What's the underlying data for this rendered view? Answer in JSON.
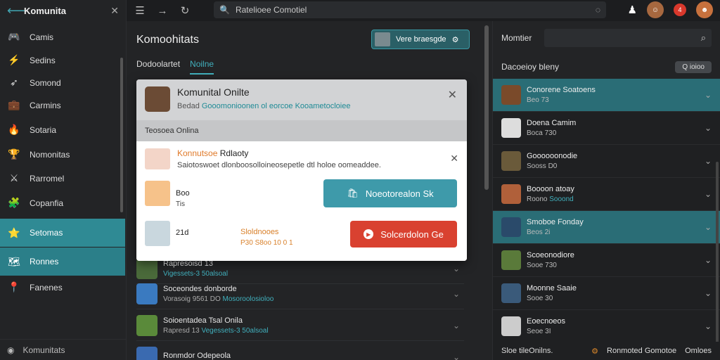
{
  "app": {
    "title": "Komunita"
  },
  "sidebar": {
    "items": [
      {
        "label": "Camis",
        "icon": "game-controller-icon",
        "icon_glyph": "🎮",
        "state": ""
      },
      {
        "label": "Sedins",
        "icon": "lightning-icon",
        "icon_glyph": "⚡",
        "state": ""
      },
      {
        "label": "Somond",
        "icon": "rocket-icon",
        "icon_glyph": "➶",
        "state": ""
      },
      {
        "label": "Carmins",
        "icon": "briefcase-icon",
        "icon_glyph": "💼",
        "state": ""
      },
      {
        "label": "Sotaria",
        "icon": "fire-icon",
        "icon_glyph": "🔥",
        "state": ""
      },
      {
        "label": "Nomonitas",
        "icon": "trophy-icon",
        "icon_glyph": "🏆",
        "state": ""
      },
      {
        "label": "Rarromel",
        "icon": "sword-icon",
        "icon_glyph": "⚔",
        "state": ""
      },
      {
        "label": "Copanfia",
        "icon": "puzzle-icon",
        "icon_glyph": "🧩",
        "state": ""
      },
      {
        "label": "Setomas",
        "icon": "star-icon",
        "icon_glyph": "⭐",
        "state": "active"
      },
      {
        "label": "Ronnes",
        "icon": "map-icon",
        "icon_glyph": "🗺",
        "state": "active2"
      },
      {
        "label": "Fanenes",
        "icon": "pin-icon",
        "icon_glyph": "📍",
        "state": ""
      }
    ],
    "footer_label": "Komunitats"
  },
  "topbar": {
    "search_placeholder": "Ratelioee Comotiel"
  },
  "middle": {
    "title": "Komoohitats",
    "new_button_label": "Vere braesgde",
    "tabs": [
      {
        "label": "Dodoolartet"
      },
      {
        "label": "Noilne"
      }
    ],
    "rows": [
      {
        "name": "Rapresoisd 13",
        "sub": "",
        "highlight": "Vigessets-3 50alsoal"
      },
      {
        "name": "Soceondes donborde",
        "sub": "Vorasoig 9561 DO",
        "highlight": "Mosoroolosioloo"
      },
      {
        "name": "Soioentadea Tsal Onila",
        "sub": "Rapresd 13",
        "highlight": "Vegessets-3 50alsoal"
      },
      {
        "name": "Ronmdor Odepeola",
        "sub": "",
        "highlight": ""
      }
    ]
  },
  "modal": {
    "title": "Komunital Onilte",
    "subtitle_plain": "Bedad",
    "subtitle_link": "Gooomonioonen ol eorcoe Kooametocloiee",
    "section": "Teosoea Onlina",
    "row1_title_orange": "Konnutsoe",
    "row1_title": "Rdlaoty",
    "row1_sub": "Saiotoswoet dlonboosolloineosepetle dtl holoe oomeaddee.",
    "item2_label": "Boo",
    "item2_sub": "Tis",
    "teal_button": "Noeotorealon Sk",
    "item3_label": "21d",
    "orange_title": "Sloldnooes",
    "orange_sub": "P30 S8oo 10 0 1",
    "red_button": "Solcerdolon Ge"
  },
  "right": {
    "header_label": "Momtier",
    "sub_label": "Dacoeioy bleny",
    "pill_label": "Q ioioo",
    "rows": [
      {
        "name": "Conorene Soatoens",
        "sub": "Beo 73",
        "hl": "",
        "state": "on"
      },
      {
        "name": "Doena Camim",
        "sub": "Boca 730",
        "hl": "",
        "state": ""
      },
      {
        "name": "Goooooonodie",
        "sub": "Sooss D0",
        "hl": "",
        "state": ""
      },
      {
        "name": "Boooon atoay",
        "sub": "Roono",
        "hl": "Sooond",
        "state": ""
      },
      {
        "name": "Smoboe Fonday",
        "sub": "Beos 2i",
        "hl": "",
        "state": "on"
      },
      {
        "name": "Scoeonodiore",
        "sub": "Sooe 730",
        "hl": "",
        "state": ""
      },
      {
        "name": "Moonne Saaie",
        "sub": "Sooe 30",
        "hl": "",
        "state": ""
      },
      {
        "name": "Eoecnoeos",
        "sub": "Seoe 3I",
        "hl": "",
        "state": ""
      }
    ],
    "footer_left": "Sloe tileOnilns.",
    "footer_mid": "Ronmoted Gomotoe",
    "footer_right": "Omloes"
  },
  "colors": {
    "accent": "#41b0bd",
    "active": "#2f8a94",
    "danger": "#d94130"
  }
}
